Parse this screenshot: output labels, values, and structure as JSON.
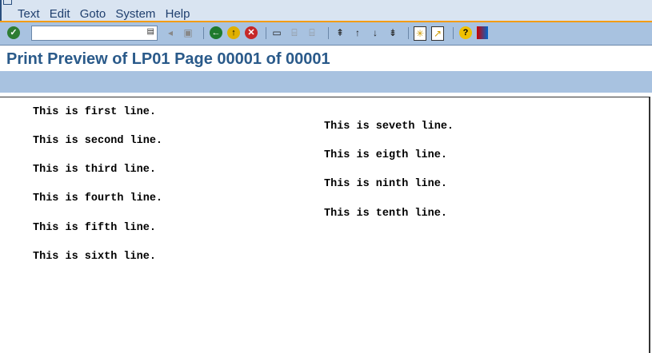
{
  "menu": [
    "Text",
    "Edit",
    "Goto",
    "System",
    "Help"
  ],
  "command_field": {
    "value": ""
  },
  "title": "Print Preview of LP01 Page 00001 of 00001",
  "lines_left": [
    "This is first line.",
    "This is second line.",
    "This is third line.",
    "This is fourth line.",
    "This is fifth line.",
    "This is sixth line."
  ],
  "lines_right": [
    "This is seveth line.",
    "This is eigth line.",
    "This is ninth line.",
    "This is tenth line."
  ]
}
